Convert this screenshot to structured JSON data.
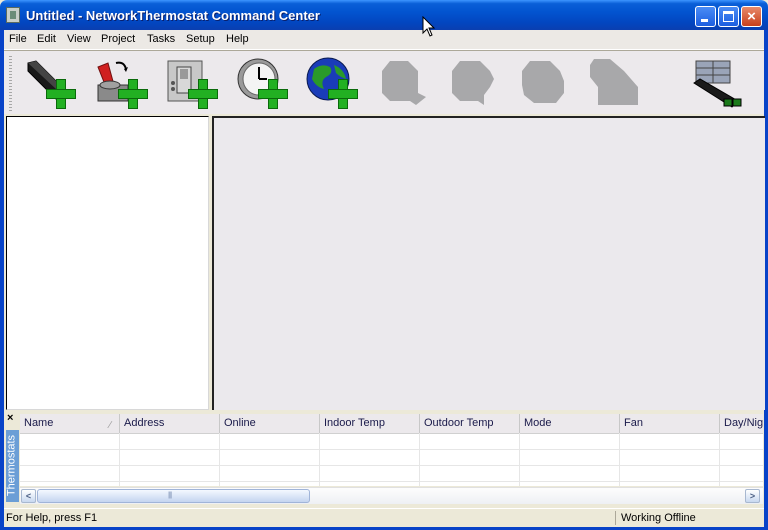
{
  "window": {
    "title": "Untitled - NetworkThermostat Command Center",
    "close_glyph": "×"
  },
  "menu": {
    "items": [
      "File",
      "Edit",
      "View",
      "Project",
      "Tasks",
      "Setup",
      "Help"
    ]
  },
  "toolbar": {
    "buttons": [
      {
        "icon": "add-network-adapter-icon",
        "enabled": true
      },
      {
        "icon": "add-switch-icon",
        "enabled": true
      },
      {
        "icon": "add-thermostat-icon",
        "enabled": true
      },
      {
        "icon": "add-schedule-clock-icon",
        "enabled": true
      },
      {
        "icon": "add-global-icon",
        "enabled": true
      },
      {
        "icon": "disabled-tool-1-icon",
        "enabled": false
      },
      {
        "icon": "disabled-tool-2-icon",
        "enabled": false
      },
      {
        "icon": "disabled-tool-3-icon",
        "enabled": false
      },
      {
        "icon": "disabled-tool-4-icon",
        "enabled": false
      },
      {
        "icon": "network-connect-icon",
        "enabled": true
      }
    ]
  },
  "thermostats_panel": {
    "tab_label": "Thermostats",
    "close_glyph": "×",
    "columns": [
      "Name",
      "Address",
      "Online",
      "Indoor Temp",
      "Outdoor Temp",
      "Mode",
      "Fan",
      "Day/Night"
    ],
    "sort_indicator": "∕",
    "rows": []
  },
  "scrollbar": {
    "left_glyph": "<",
    "right_glyph": ">"
  },
  "status": {
    "help_text": "For Help, press F1",
    "connection": "Working Offline"
  }
}
